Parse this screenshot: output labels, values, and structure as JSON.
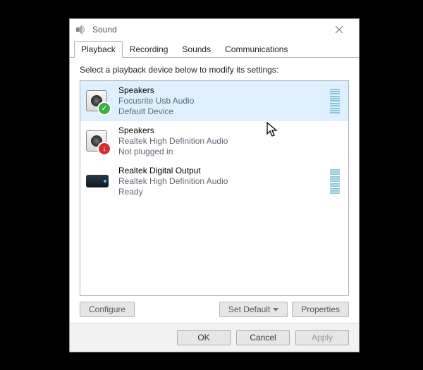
{
  "titlebar": {
    "title": "Sound"
  },
  "tabs": {
    "playback": "Playback",
    "recording": "Recording",
    "sounds": "Sounds",
    "communications": "Communications"
  },
  "instruction": "Select a playback device below to modify its settings:",
  "devices": [
    {
      "name": "Speakers",
      "driver": "Focusrite Usb Audio",
      "status": "Default Device",
      "badge": "ok",
      "level": true,
      "selected": true,
      "icon": "speaker"
    },
    {
      "name": "Speakers",
      "driver": "Realtek High Definition Audio",
      "status": "Not plugged in",
      "badge": "err",
      "level": false,
      "selected": false,
      "icon": "speaker"
    },
    {
      "name": "Realtek Digital Output",
      "driver": "Realtek High Definition Audio",
      "status": "Ready",
      "badge": null,
      "level": true,
      "selected": false,
      "icon": "digital"
    }
  ],
  "buttons": {
    "configure": "Configure",
    "set_default": "Set Default",
    "properties": "Properties",
    "ok": "OK",
    "cancel": "Cancel",
    "apply": "Apply"
  }
}
